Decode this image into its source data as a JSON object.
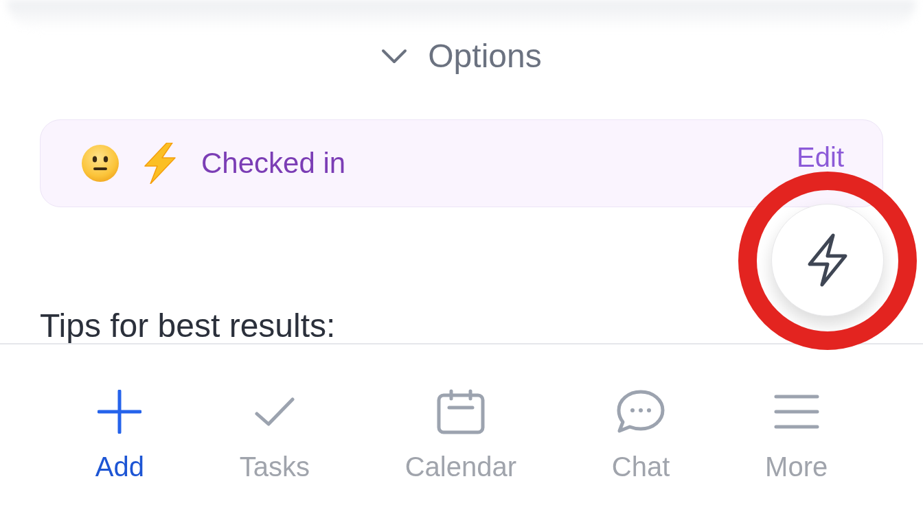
{
  "options_toggle": {
    "label": "Options",
    "expanded": false
  },
  "checkin_card": {
    "status": "Checked in",
    "action": "Edit"
  },
  "tips": {
    "heading": "Tips for best results:"
  },
  "bottom_nav": [
    {
      "label": "Add",
      "selected": true
    },
    {
      "label": "Tasks",
      "selected": false
    },
    {
      "label": "Calendar",
      "selected": false
    },
    {
      "label": "Chat",
      "selected": false
    },
    {
      "label": "More",
      "selected": false
    }
  ]
}
